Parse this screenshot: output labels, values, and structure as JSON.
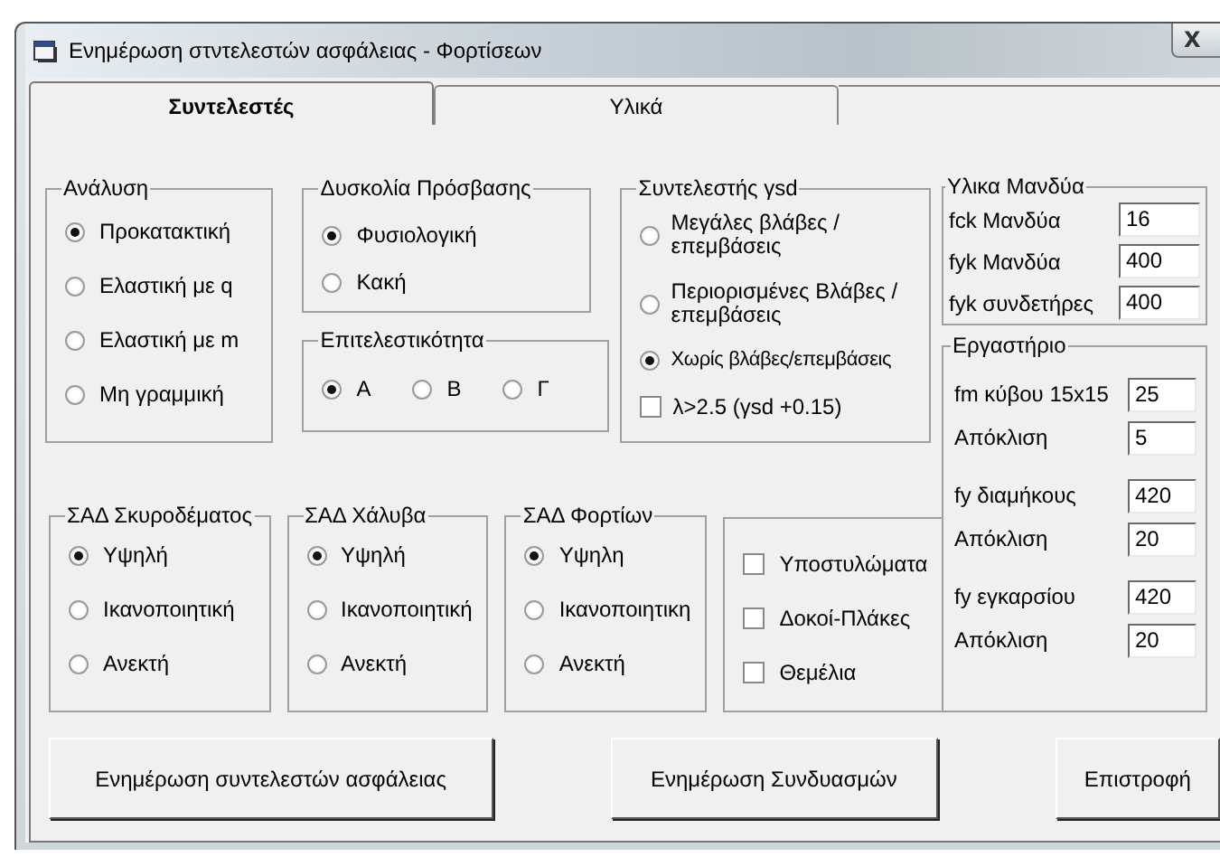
{
  "window": {
    "title": "Ενημέρωση στντελεστών ασφάλειας - Φορτίσεων",
    "close_glyph": "X"
  },
  "tabs": [
    {
      "label": "Συντελεστές",
      "selected": true
    },
    {
      "label": "Υλικά",
      "selected": false
    }
  ],
  "analysis": {
    "title": "Ανάλυση",
    "options": [
      {
        "label": "Προκατακτική",
        "selected": true
      },
      {
        "label": "Ελαστική με q",
        "selected": false
      },
      {
        "label": "Ελαστική με m",
        "selected": false
      },
      {
        "label": "Μη γραμμική",
        "selected": false
      }
    ]
  },
  "access": {
    "title": "Δυσκολία Πρόσβασης",
    "options": [
      {
        "label": "Φυσιολογική",
        "selected": true
      },
      {
        "label": "Κακή",
        "selected": false
      }
    ]
  },
  "performance": {
    "title": "Επιτελεστικότητα",
    "options": [
      {
        "label": "A",
        "selected": true
      },
      {
        "label": "B",
        "selected": false
      },
      {
        "label": "Γ",
        "selected": false
      }
    ]
  },
  "ysd": {
    "title": "Συντελεστής γsd",
    "options": [
      {
        "label": "Μεγάλες βλάβες / επεμβάσεις",
        "selected": false
      },
      {
        "label": "Περιορισμένες Βλάβες / επεμβάσεις",
        "selected": false
      },
      {
        "label": "Χωρίς βλάβες/επεμβάσεις",
        "selected": true
      }
    ],
    "check": {
      "label": "λ>2.5 (γsd +0.15)",
      "checked": false
    }
  },
  "sad_groups": [
    {
      "title": "ΣΑΔ Σκυροδέματος",
      "options": [
        {
          "label": "Υψηλή",
          "selected": true
        },
        {
          "label": "Ικανοποιητική",
          "selected": false
        },
        {
          "label": "Ανεκτή",
          "selected": false
        }
      ]
    },
    {
      "title": "ΣΑΔ Χάλυβα",
      "options": [
        {
          "label": "Υψηλή",
          "selected": true
        },
        {
          "label": "Ικανοποιητική",
          "selected": false
        },
        {
          "label": "Ανεκτή",
          "selected": false
        }
      ]
    },
    {
      "title": "ΣΑΔ Φορτίων",
      "options": [
        {
          "label": "Υψηλη",
          "selected": true
        },
        {
          "label": "Ικανοποιητικη",
          "selected": false
        },
        {
          "label": "Ανεκτή",
          "selected": false
        }
      ]
    }
  ],
  "elements": [
    {
      "label": "Υποστυλώματα",
      "checked": false
    },
    {
      "label": "Δοκοί-Πλάκες",
      "checked": false
    },
    {
      "label": "Θεμέλια",
      "checked": false
    }
  ],
  "jacket": {
    "title": "Υλικα Μανδύα",
    "fields": [
      {
        "label": "fck Μανδύα",
        "value": "16"
      },
      {
        "label": "fyk Μανδύα",
        "value": "400"
      },
      {
        "label": "fyk συνδετήρες",
        "value": "400"
      }
    ]
  },
  "lab": {
    "title": "Εργαστήριο",
    "fields": [
      {
        "label": "fm κύβου 15x15",
        "value": "25"
      },
      {
        "label": "Απόκλιση",
        "value": "5"
      },
      {
        "label": "fy διαμήκους",
        "value": "420"
      },
      {
        "label": "Απόκλιση",
        "value": "20"
      },
      {
        "label": "fy εγκαρσίου",
        "value": "420"
      },
      {
        "label": "Απόκλιση",
        "value": "20"
      }
    ]
  },
  "buttons": [
    {
      "label": "Ενημέρωση συντελεστών ασφάλειας"
    },
    {
      "label": "Ενημέρωση Συνδυασμών"
    },
    {
      "label": "Επιστροφή"
    }
  ]
}
